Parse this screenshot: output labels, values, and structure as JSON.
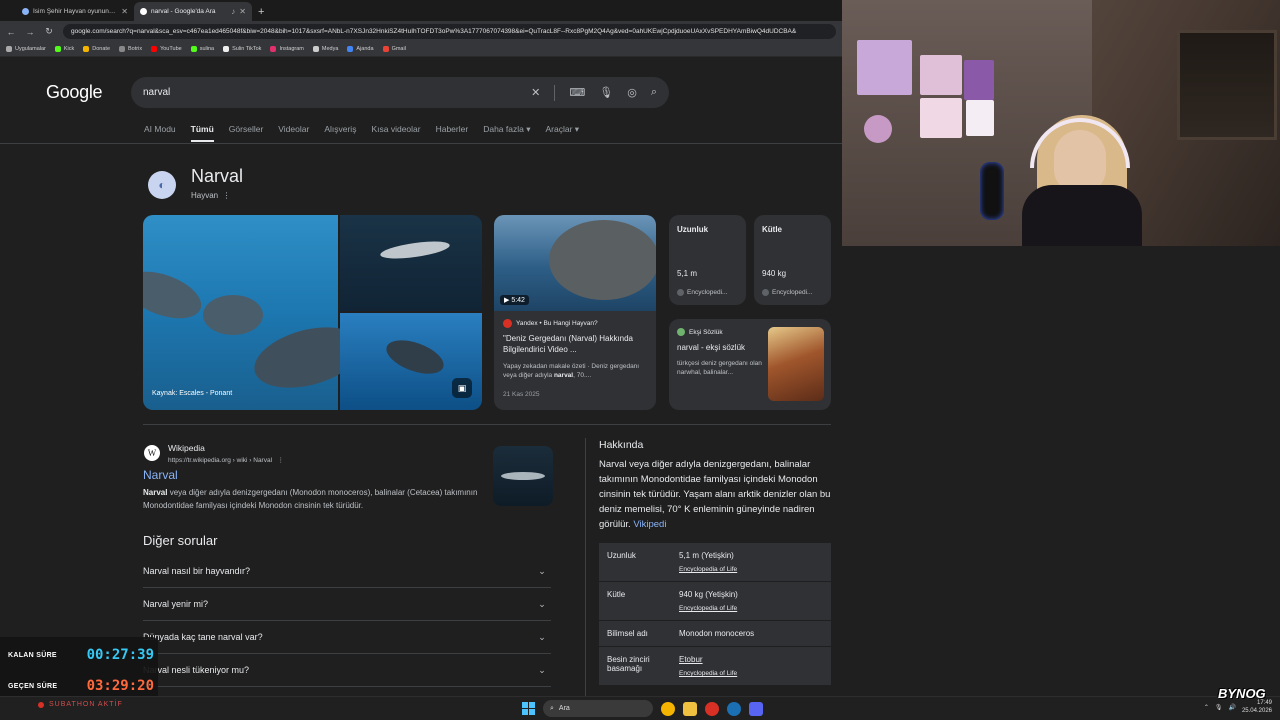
{
  "browser": {
    "tabs": [
      {
        "title": "İsim Şehir Hayvan oyununa kat",
        "active": false
      },
      {
        "title": "narval - Google'da Ara",
        "active": true
      }
    ],
    "url": "google.com/search?q=narval&sca_esv=c467ea1ed465048f&biw=2048&bih=1017&sxsrf=ANbL-n7XSJn32HnkiSZ4tHuIhTOFDT3oPw%3A1777067074398&ei=QuTracL8F--Rxc8PgM2Q4Ag&ved=0ahUKEwjCpdjduoeUAxXvSPEDHYAmBiwQ4dUDCBA&",
    "bookmarks": [
      "Uygulamalar",
      "Kick",
      "Donate",
      "Botrix",
      "YouTube",
      "sulina",
      "Sulin TikTok",
      "Instagram",
      "Medya",
      "Ajanda",
      "Gmail"
    ]
  },
  "google": {
    "logo": "Google",
    "query": "narval",
    "tabs": [
      "AI Modu",
      "Tümü",
      "Görseller",
      "Videolar",
      "Alışveriş",
      "Kısa videolar",
      "Haberler",
      "Daha fazla",
      "Araçlar"
    ],
    "active_tab": "Tümü"
  },
  "entity": {
    "title": "Narval",
    "subtitle": "Hayvan",
    "image_caption": "Kaynak: Escales - Ponant"
  },
  "video_card": {
    "duration": "5:42",
    "source": "Yandex • Bu Hangi Hayvan?",
    "title": "\"Deniz Gergedanı (Narval) Hakkında Bilgilendirici Video ...",
    "desc_pre": "Yapay zekadan makale özeti · Deniz gergedanı veya diğer adıyla ",
    "desc_bold": "narval",
    "desc_post": ", 70....",
    "date": "21 Kas 2025"
  },
  "facts": [
    {
      "label": "Uzunluk",
      "value": "5,1 m",
      "source": "Encyclopedi..."
    },
    {
      "label": "Kütle",
      "value": "940 kg",
      "source": "Encyclopedi..."
    }
  ],
  "eksi": {
    "source": "Ekşi Sözlük",
    "title": "narval - ekşi sözlük",
    "desc": "türkçesi deniz gergedanı olan narwhal, balinalar..."
  },
  "wiki": {
    "name": "Wikipedia",
    "url": "https://tr.wikipedia.org › wiki › Narval",
    "link": "Narval",
    "snip_bold": "Narval",
    "snip": " veya diğer adıyla denizgergedanı (Monodon monoceros), balinalar (Cetacea) takımının Monodontidae familyası içindeki Monodon cinsinin tek türüdür."
  },
  "paa": {
    "title": "Diğer sorular",
    "items": [
      "Narval nasıl bir hayvandır?",
      "Narval yenir mi?",
      "Dünyada kaç tane narval var?",
      "Narval nesli tükeniyor mu?"
    ]
  },
  "about": {
    "heading": "Hakkında",
    "text": "Narval veya diğer adıyla denizgergedanı, balinalar takımının Monodontidae familyası içindeki Monodon cinsinin tek türüdür. Yaşam alanı arktik denizler olan bu deniz memelisi, 70° K enleminin güneyinde nadiren görülür.",
    "link": "Vikipedi",
    "rows": [
      {
        "k": "Uzunluk",
        "v": "5,1 m (Yetişkin)",
        "src": "Encyclopedia of Life"
      },
      {
        "k": "Kütle",
        "v": "940 kg (Yetişkin)",
        "src": "Encyclopedia of Life"
      },
      {
        "k": "Bilimsel adı",
        "v": "Monodon monoceros",
        "src": ""
      },
      {
        "k": "Besin zinciri basamağı",
        "v": "Etobur",
        "src": "Encyclopedia of Life"
      }
    ]
  },
  "overlay": {
    "remaining_label": "KALAN SÜRE",
    "remaining": "00:27:39",
    "elapsed_label": "GEÇEN SÜRE",
    "elapsed": "03:29:20",
    "subathon": "SUBATHON AKTİF",
    "remaining_color": "#36c9f5",
    "elapsed_color": "#ff6a3d",
    "brand": "BYNOG"
  },
  "taskbar": {
    "search": "Ara",
    "time": "17:49",
    "date": "25.04.2026"
  }
}
